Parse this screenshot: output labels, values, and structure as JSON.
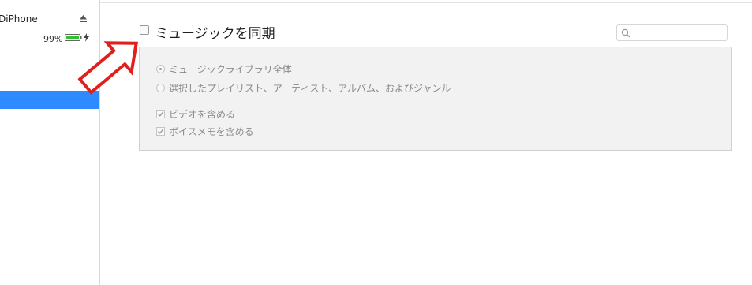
{
  "sidebar": {
    "device_name": "DiPhone",
    "battery_percent": "99%",
    "battery_level": 0.99,
    "eject_icon": "eject-icon",
    "charging_icon": "bolt-icon"
  },
  "main": {
    "sync_title": "ミュージックを同期",
    "sync_checked": false,
    "search": {
      "placeholder": "",
      "value": "",
      "icon": "search-icon"
    },
    "options": {
      "radio_entire_library": "ミュージックライブラリ全体",
      "radio_selected": "選択したプレイリスト、アーティスト、アルバム、およびジャンル",
      "check_videos": "ビデオを含める",
      "check_voice_memos": "ボイスメモを含める"
    }
  },
  "colors": {
    "selection": "#2e8bff",
    "battery": "#33c12f",
    "annotation_arrow": "#e0201c"
  }
}
